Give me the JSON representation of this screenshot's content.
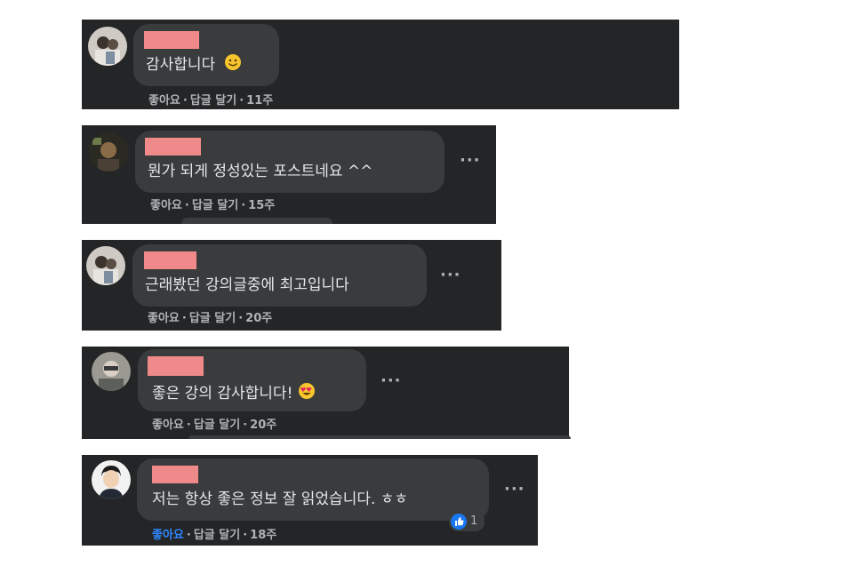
{
  "comments": [
    {
      "text": "감사합니다",
      "emoji": "smile",
      "like": "좋아요",
      "reply": "답글 달기",
      "time": "11주",
      "more": ""
    },
    {
      "text": "뭔가 되게 정성있는 포스트네요 ^^",
      "emoji": "",
      "like": "좋아요",
      "reply": "답글 달기",
      "time": "15주",
      "more": "···"
    },
    {
      "text": "근래봤던 강의글중에 최고입니다",
      "emoji": "",
      "like": "좋아요",
      "reply": "답글 달기",
      "time": "20주",
      "more": "···"
    },
    {
      "text": "좋은 강의 감사합니다!",
      "emoji": "heart-eyes",
      "like": "좋아요",
      "reply": "답글 달기",
      "time": "20주",
      "more": "···"
    },
    {
      "text": "저는 항상 좋은 정보 잘 읽었습니다. ㅎㅎ",
      "emoji": "",
      "like": "좋아요",
      "reply": "답글 달기",
      "time": "18주",
      "more": "···",
      "reaction_count": "1",
      "liked": true
    }
  ],
  "separator": "·",
  "colors": {
    "card_bg": "#242526",
    "bubble_bg": "#3a3b3c",
    "text": "#e4e6eb",
    "meta": "#b0b3b8",
    "like_active": "#2d88ff",
    "redaction": "#f08a8a"
  }
}
